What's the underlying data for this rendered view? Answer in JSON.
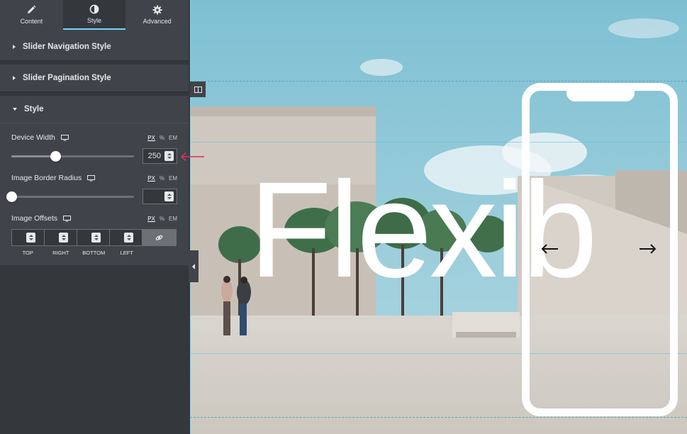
{
  "panel": {
    "tabs": [
      {
        "label": "Content",
        "icon": "pencil-icon"
      },
      {
        "label": "Style",
        "icon": "half-circle-icon"
      },
      {
        "label": "Advanced",
        "icon": "gear-icon"
      }
    ],
    "active_tab": "Style",
    "sections": {
      "nav_style": "Slider Navigation Style",
      "pagination_style": "Slider Pagination Style",
      "style": "Style"
    },
    "controls": {
      "device_width": {
        "label": "Device Width",
        "units": [
          "PX",
          "%",
          "EM"
        ],
        "active_unit": "PX",
        "value": "250",
        "slider_fraction": 0.36
      },
      "border_radius": {
        "label": "Image Border Radius",
        "units": [
          "PX",
          "%",
          "EM"
        ],
        "active_unit": "PX",
        "value": "",
        "slider_fraction": 0
      },
      "image_offsets": {
        "label": "Image Offsets",
        "units": [
          "PX",
          "%",
          "EM"
        ],
        "active_unit": "PX",
        "fields": [
          "TOP",
          "RIGHT",
          "BOTTOM",
          "LEFT"
        ]
      }
    }
  },
  "preview": {
    "headline": "Flexib",
    "prev_arrow": "arrow-left-icon",
    "next_arrow": "arrow-right-icon"
  },
  "colors": {
    "panel_bg": "#34373c",
    "section_bg": "#404349",
    "accent": "#71d7f7",
    "annotation_arrow": "#d6335a"
  }
}
